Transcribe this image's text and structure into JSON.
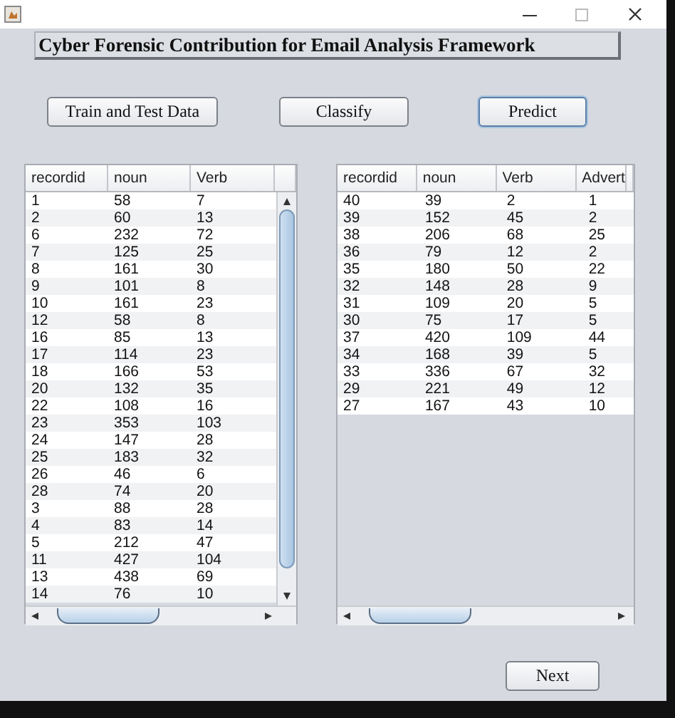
{
  "heading": "Cyber Forensic Contribution for Email Analysis Framework",
  "buttons": [
    {
      "label": "Train and Test Data",
      "focused": false
    },
    {
      "label": "Classify",
      "focused": false
    },
    {
      "label": "Predict",
      "focused": true
    }
  ],
  "tables": [
    {
      "columns": [
        "recordid",
        "noun",
        "Verb"
      ],
      "rows": [
        [
          "1",
          "58",
          "7"
        ],
        [
          "2",
          "60",
          "13"
        ],
        [
          "6",
          "232",
          "72"
        ],
        [
          "7",
          "125",
          "25"
        ],
        [
          "8",
          "161",
          "30"
        ],
        [
          "9",
          "101",
          "8"
        ],
        [
          "10",
          "161",
          "23"
        ],
        [
          "12",
          "58",
          "8"
        ],
        [
          "16",
          "85",
          "13"
        ],
        [
          "17",
          "114",
          "23"
        ],
        [
          "18",
          "166",
          "53"
        ],
        [
          "20",
          "132",
          "35"
        ],
        [
          "22",
          "108",
          "16"
        ],
        [
          "23",
          "353",
          "103"
        ],
        [
          "24",
          "147",
          "28"
        ],
        [
          "25",
          "183",
          "32"
        ],
        [
          "26",
          "46",
          "6"
        ],
        [
          "28",
          "74",
          "20"
        ],
        [
          "3",
          "88",
          "28"
        ],
        [
          "4",
          "83",
          "14"
        ],
        [
          "5",
          "212",
          "47"
        ],
        [
          "11",
          "427",
          "104"
        ],
        [
          "13",
          "438",
          "69"
        ],
        [
          "14",
          "76",
          "10"
        ]
      ]
    },
    {
      "columns": [
        "recordid",
        "noun",
        "Verb",
        "Advert"
      ],
      "rows": [
        [
          "40",
          "39",
          "2",
          "1"
        ],
        [
          "39",
          "152",
          "45",
          "2"
        ],
        [
          "38",
          "206",
          "68",
          "25"
        ],
        [
          "36",
          "79",
          "12",
          "2"
        ],
        [
          "35",
          "180",
          "50",
          "22"
        ],
        [
          "32",
          "148",
          "28",
          "9"
        ],
        [
          "31",
          "109",
          "20",
          "5"
        ],
        [
          "30",
          "75",
          "17",
          "5"
        ],
        [
          "37",
          "420",
          "109",
          "44"
        ],
        [
          "34",
          "168",
          "39",
          "5"
        ],
        [
          "33",
          "336",
          "67",
          "32"
        ],
        [
          "29",
          "221",
          "49",
          "12"
        ],
        [
          "27",
          "167",
          "43",
          "10"
        ]
      ]
    }
  ],
  "next_button": {
    "label": "Next",
    "focused": false
  }
}
